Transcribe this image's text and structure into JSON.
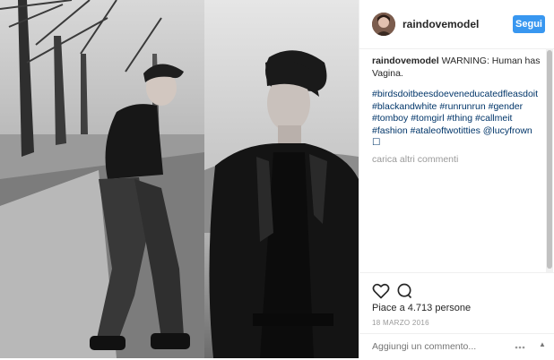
{
  "post": {
    "username": "raindovemodel",
    "follow_label": "Segui",
    "caption_user": "raindovemodel",
    "caption_text": " WARNING: Human has Vagina.",
    "hashtags": [
      "#birdsdoitbeesdoeveneducatedfleasdoit",
      "#blackandwhite",
      "#runrunrun",
      "#gender",
      "#tomboy",
      "#tomgirl",
      "#thing",
      "#callmeit",
      "#fashion",
      "#ataleoftwotitties",
      "@lucyfrown",
      "☐"
    ],
    "more_comments_label": "carica altri commenti",
    "likes_text": "Piace a 4.713 persone",
    "date_text": "18 MARZO 2016",
    "comment_placeholder": "Aggiungi un commento...",
    "scroll_up_glyph": "▲"
  },
  "icons": {
    "like": "heart-icon",
    "comment": "comment-icon",
    "options": "more-options-icon"
  },
  "colors": {
    "follow_button": "#3897f0",
    "hashtag": "#003569",
    "muted": "#999999"
  }
}
